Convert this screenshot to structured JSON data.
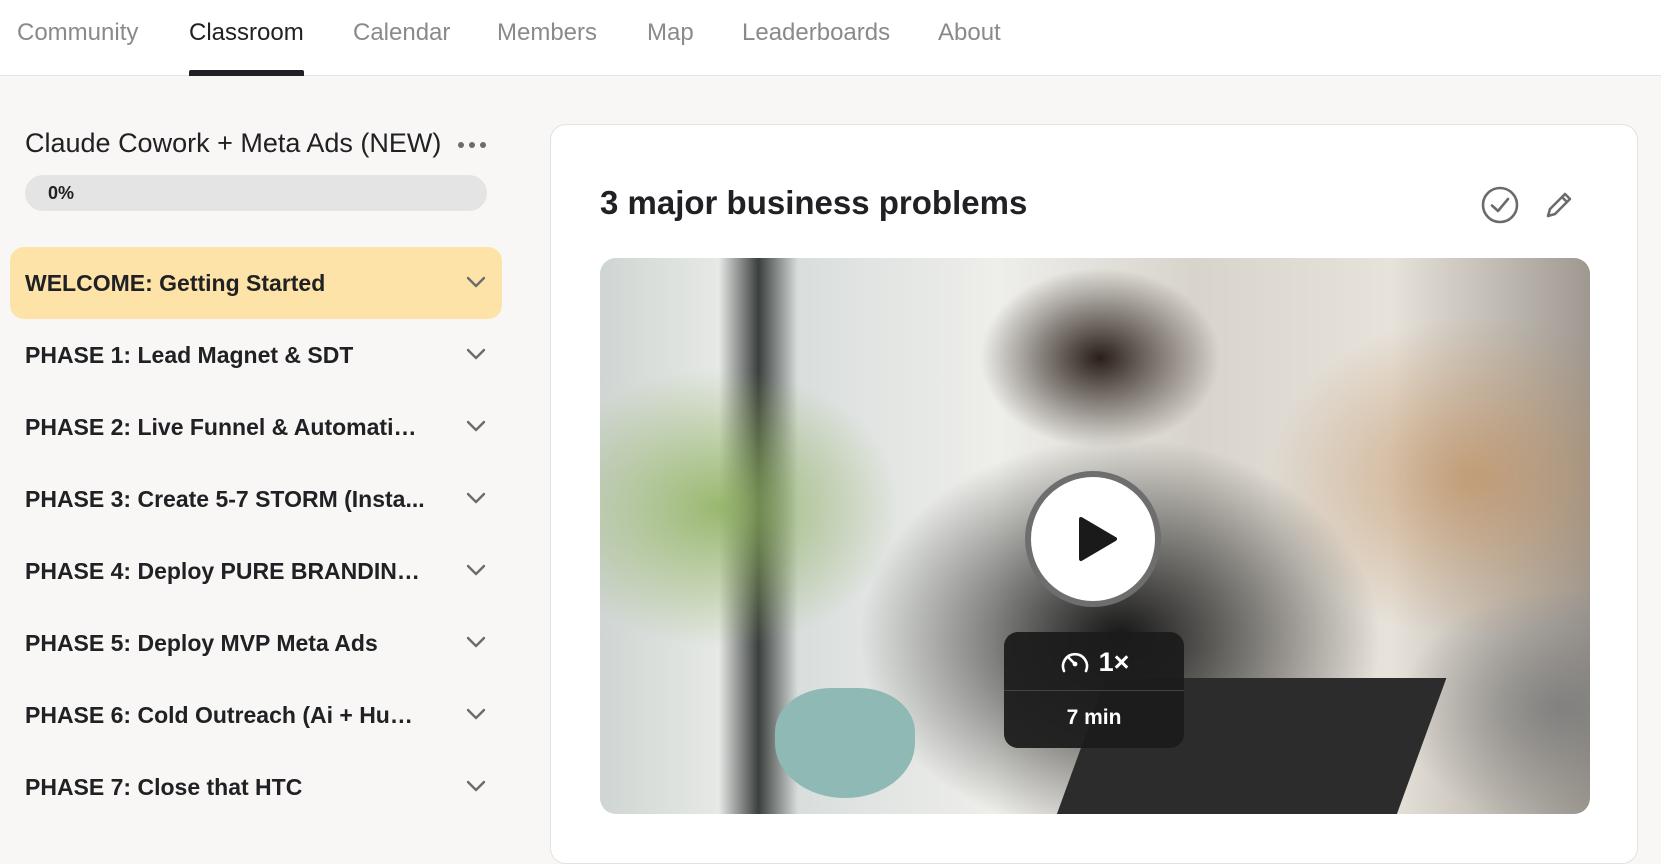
{
  "nav": {
    "tabs": [
      {
        "label": "Community"
      },
      {
        "label": "Classroom"
      },
      {
        "label": "Calendar"
      },
      {
        "label": "Members"
      },
      {
        "label": "Map"
      },
      {
        "label": "Leaderboards"
      },
      {
        "label": "About"
      }
    ],
    "active_tab": "Classroom"
  },
  "course": {
    "title": "Claude Cowork + Meta Ads (NEW)",
    "progress_label": "0%",
    "progress": 0
  },
  "modules": [
    {
      "label": "WELCOME: Getting Started",
      "active": true
    },
    {
      "label": "PHASE 1: Lead Magnet & SDT"
    },
    {
      "label": "PHASE 2: Live Funnel & Automations"
    },
    {
      "label": "PHASE 3: Create 5-7 STORM (Insta..."
    },
    {
      "label": "PHASE 4: Deploy PURE BRANDING ..."
    },
    {
      "label": "PHASE 5: Deploy MVP Meta Ads"
    },
    {
      "label": "PHASE 6: Cold Outreach (Ai + Hum..."
    },
    {
      "label": "PHASE 7: Close that HTC"
    }
  ],
  "lesson": {
    "title": "3 major business problems",
    "speed": "1×",
    "duration": "7 min"
  },
  "colors": {
    "active_module_bg": "#fde3a7",
    "nav_active": "#202124",
    "nav_inactive": "#8a8a8a"
  }
}
